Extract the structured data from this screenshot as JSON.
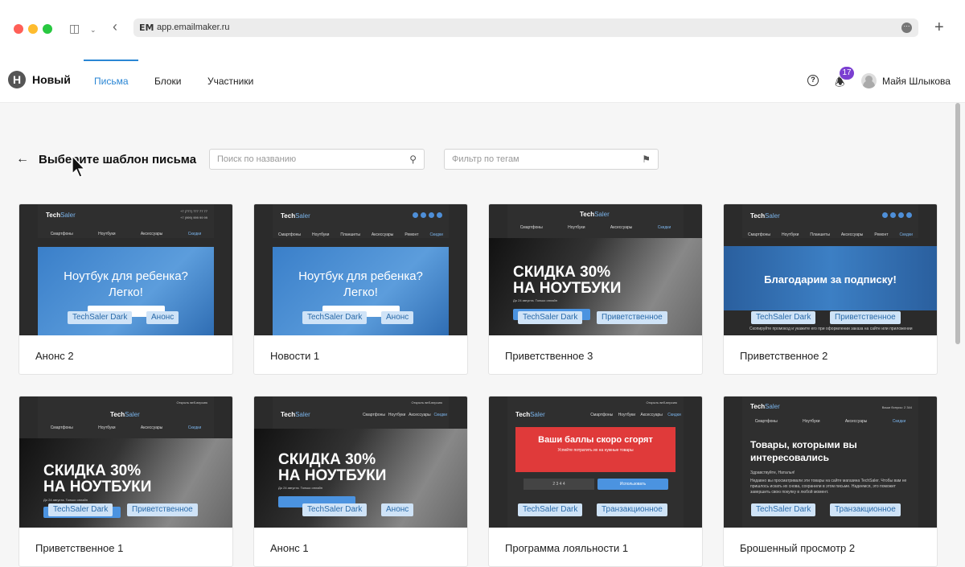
{
  "browser": {
    "url_favicon": "EM",
    "url": "app.emailmaker.ru"
  },
  "app": {
    "logo_letter": "Н",
    "workspace": "Новый",
    "tabs": [
      "Письма",
      "Блоки",
      "Участники"
    ],
    "active_tab": "Письма",
    "help_icon": "?",
    "notifications_count": "17",
    "user_name": "Майя Шлыкова"
  },
  "toolbar": {
    "title": "Выберите шаблон письма",
    "search_placeholder": "Поиск по названию",
    "tag_placeholder": "Фильтр по тегам"
  },
  "thumb_common": {
    "logo_main": "Tech",
    "logo_accent": "Saler",
    "nav_main": [
      "Смартфоны",
      "Ноутбуки",
      "Аксессуары",
      "Скидки"
    ],
    "nav_ext": [
      "Смартфоны",
      "Ноутбуки",
      "Планшеты",
      "Аксессуары",
      "Ремонт",
      "Скидки"
    ],
    "hero_notebook": "Ноутбук для ребенка? Легко!",
    "hero_sale_1": "СКИДКА 30%",
    "hero_sale_2": "НА НОУТБУКИ",
    "hero_sale_small": "До 24 августа. Только онлайн",
    "hero_thanks": "Благодарим за подписку!",
    "thanks_small": "Скопируйте промокод и укажите его при оформлении заказа на сайте или приложении",
    "points_title": "Ваши баллы скоро сгорят",
    "points_sub": "Успейте потратить их на нужные товары",
    "points_code": "2 3 4 4",
    "points_btn": "Использовать",
    "abandoned_title": "Товары, которыми вы интересовались",
    "abandoned_greeting": "Здравствуйте, Наталья!",
    "abandoned_body": "Недавно вы просматривали эти товары на сайте магазина TechSaler. Чтобы вам не пришлось искать их снова, сохранили в этом письме. Надеемся, это поможет завершить свою покупку в любой момент.",
    "abandoned_bonus": "Ваши бонусы: 2 344",
    "web_version": "Открыть веб-версию",
    "phone_1": "+7 (777) 777 77 77",
    "phone_2": "+7 (999) 999 99 99"
  },
  "templates": [
    {
      "name": "Анонс 2",
      "tags": [
        "TechSaler Dark",
        "Анонс"
      ]
    },
    {
      "name": "Новости 1",
      "tags": [
        "TechSaler Dark",
        "Анонс"
      ]
    },
    {
      "name": "Приветственное 3",
      "tags": [
        "TechSaler Dark",
        "Приветственное"
      ]
    },
    {
      "name": "Приветственное 2",
      "tags": [
        "TechSaler Dark",
        "Приветственное"
      ]
    },
    {
      "name": "Приветственное 1",
      "tags": [
        "TechSaler Dark",
        "Приветственное"
      ]
    },
    {
      "name": "Анонс 1",
      "tags": [
        "TechSaler Dark",
        "Анонс"
      ]
    },
    {
      "name": "Программа лояльности 1",
      "tags": [
        "TechSaler Dark",
        "Транзакционное"
      ]
    },
    {
      "name": "Брошенный просмотр 2",
      "tags": [
        "TechSaler Dark",
        "Транзакционное"
      ]
    }
  ],
  "colors": {
    "accent": "#2a86d4",
    "badge": "#7b3fd1",
    "chip_bg": "#cfe3f7",
    "thumb_bg": "#2b2b2b"
  }
}
